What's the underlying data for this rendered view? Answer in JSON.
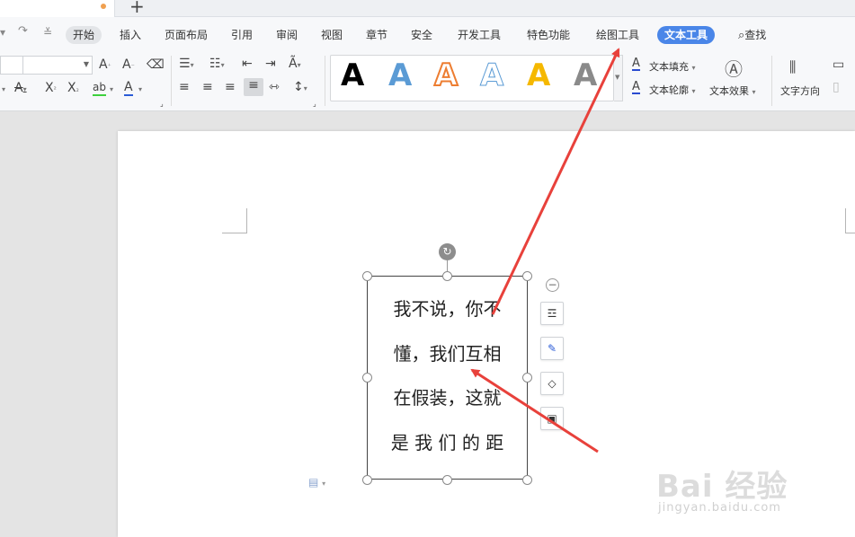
{
  "menu": {
    "items": [
      {
        "id": "start",
        "label": "开始"
      },
      {
        "id": "insert",
        "label": "插入"
      },
      {
        "id": "layout",
        "label": "页面布局"
      },
      {
        "id": "references",
        "label": "引用"
      },
      {
        "id": "review",
        "label": "审阅"
      },
      {
        "id": "view",
        "label": "视图"
      },
      {
        "id": "section",
        "label": "章节"
      },
      {
        "id": "security",
        "label": "安全"
      },
      {
        "id": "developer",
        "label": "开发工具"
      },
      {
        "id": "features",
        "label": "特色功能"
      },
      {
        "id": "drawing_tools",
        "label": "绘图工具"
      },
      {
        "id": "text_tools",
        "label": "文本工具"
      }
    ],
    "search_label": "查找"
  },
  "ribbon": {
    "text_fill_label": "文本填充",
    "text_outline_label": "文本轮廓",
    "text_effect_label": "文本效果",
    "text_direction_label": "文字方向",
    "gallery_letter": "A",
    "colors": {
      "black": "#000000",
      "blue": "#5b9bd5",
      "orange": "#ed7d31",
      "outline_blue": "#5b9bd5",
      "gold": "#f5b800",
      "gray": "#7f7f7f"
    }
  },
  "document": {
    "textbox_lines": [
      "我不说，你不",
      "懂，我们互相",
      "在假装，这就",
      "是 我 们 的 距"
    ]
  },
  "watermark": {
    "brand": "Bai 经验",
    "url": "jingyan.baidu.com"
  },
  "annotation_color": "#e8413b"
}
